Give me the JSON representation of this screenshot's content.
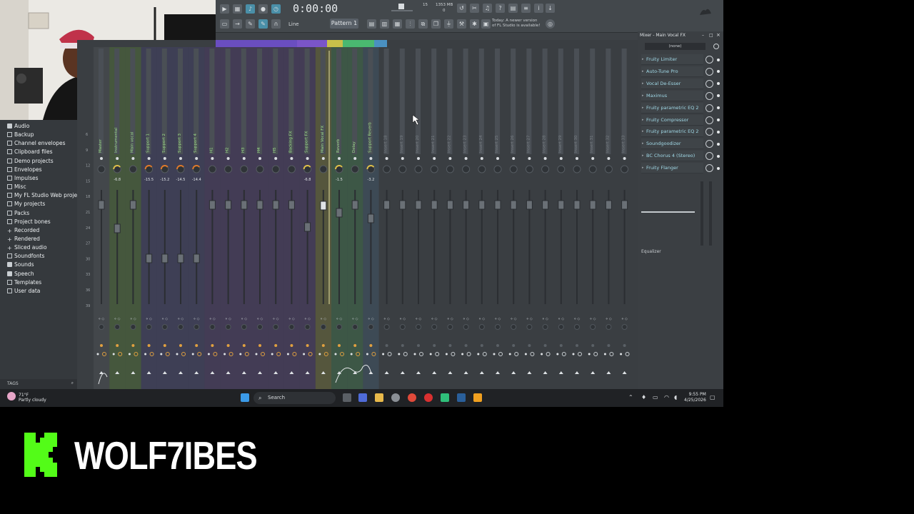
{
  "toolbar": {
    "time": "0:00:00",
    "pattern": "Pattern 1",
    "snap": "Line",
    "notice": "Today: A newer version of FL Studio is available!",
    "cpu": "15",
    "mem": "1353 MB",
    "voices": "0"
  },
  "browser": {
    "items": [
      {
        "label": "Audio",
        "icon": "speaker-icon"
      },
      {
        "label": "Backup",
        "icon": "folder-icon"
      },
      {
        "label": "Channel envelopes",
        "icon": "folder-icon"
      },
      {
        "label": "Clipboard files",
        "icon": "folder-icon"
      },
      {
        "label": "Demo projects",
        "icon": "folder-icon"
      },
      {
        "label": "Envelopes",
        "icon": "folder-icon"
      },
      {
        "label": "Impulses",
        "icon": "folder-icon"
      },
      {
        "label": "Misc",
        "icon": "folder-icon"
      },
      {
        "label": "My FL Studio Web projects",
        "icon": "folder-icon"
      },
      {
        "label": "My projects",
        "icon": "folder-icon"
      },
      {
        "label": "Packs",
        "icon": "folder-icon"
      },
      {
        "label": "Project bones",
        "icon": "folder-icon"
      },
      {
        "label": "Recorded",
        "icon": "plus-icon"
      },
      {
        "label": "Rendered",
        "icon": "plus-icon"
      },
      {
        "label": "Sliced audio",
        "icon": "plus-icon"
      },
      {
        "label": "Soundfonts",
        "icon": "folder-icon"
      },
      {
        "label": "Sounds",
        "icon": "speaker-icon"
      },
      {
        "label": "Speech",
        "icon": "speaker-icon"
      },
      {
        "label": "Templates",
        "icon": "folder-icon"
      },
      {
        "label": "User data",
        "icon": "folder-icon"
      }
    ],
    "tags_label": "TAGS"
  },
  "mixer": {
    "tracks": [
      {
        "name": "Master",
        "db": "",
        "color": "#4a4f54"
      },
      {
        "name": "Instrumental",
        "db": "-6.8",
        "color": "#4f6b3a"
      },
      {
        "name": "Main vocal",
        "db": "",
        "color": "#4f6b3a"
      },
      {
        "name": "Support 1",
        "db": "-15.5",
        "color": "#423f66"
      },
      {
        "name": "Support 2",
        "db": "-15.2",
        "color": "#423f66"
      },
      {
        "name": "Support 3",
        "db": "-14.5",
        "color": "#423f66"
      },
      {
        "name": "Support 4",
        "db": "-14.4",
        "color": "#423f66"
      },
      {
        "name": "H1",
        "db": "",
        "color": "#4a3a66"
      },
      {
        "name": "H2",
        "db": "",
        "color": "#4a3a66"
      },
      {
        "name": "H3",
        "db": "",
        "color": "#4a3a66"
      },
      {
        "name": "H4",
        "db": "",
        "color": "#4a3a66"
      },
      {
        "name": "H5",
        "db": "",
        "color": "#4a3a66"
      },
      {
        "name": "Backing FX",
        "db": "",
        "color": "#4a3a66"
      },
      {
        "name": "Support FX",
        "db": "-6.8",
        "color": "#4a3a66"
      },
      {
        "name": "Main Vocal FX",
        "db": "",
        "color": "#6b6a3a"
      },
      {
        "name": "Reverb",
        "db": "-1.5",
        "color": "#3f6b4a"
      },
      {
        "name": "Delay",
        "db": "",
        "color": "#3f6b4a"
      },
      {
        "name": "Support Reverb",
        "db": "-3.2",
        "color": "#3f5466"
      },
      {
        "name": "Insert 18",
        "db": "",
        "color": ""
      },
      {
        "name": "Insert 19",
        "db": "",
        "color": ""
      },
      {
        "name": "Insert 20",
        "db": "",
        "color": ""
      },
      {
        "name": "Insert 21",
        "db": "",
        "color": ""
      },
      {
        "name": "Insert 22",
        "db": "",
        "color": ""
      },
      {
        "name": "Insert 23",
        "db": "",
        "color": ""
      },
      {
        "name": "Insert 24",
        "db": "",
        "color": ""
      },
      {
        "name": "Insert 25",
        "db": "",
        "color": ""
      },
      {
        "name": "Insert 26",
        "db": "",
        "color": ""
      },
      {
        "name": "Insert 27",
        "db": "",
        "color": ""
      },
      {
        "name": "Insert 28",
        "db": "",
        "color": ""
      },
      {
        "name": "Insert 29",
        "db": "",
        "color": ""
      },
      {
        "name": "Insert 30",
        "db": "",
        "color": ""
      },
      {
        "name": "Insert 31",
        "db": "",
        "color": ""
      },
      {
        "name": "Insert 32",
        "db": "",
        "color": ""
      },
      {
        "name": "Insert 33",
        "db": "",
        "color": ""
      }
    ],
    "scale": [
      "6",
      "9",
      "12",
      "15",
      "18",
      "21",
      "24",
      "27",
      "30",
      "33",
      "36",
      "39"
    ]
  },
  "panel": {
    "title": "Mixer - Main Vocal FX",
    "input": "(none)",
    "slots": [
      "Fruity Limiter",
      "Auto-Tune Pro",
      "Vocal De-Esser",
      "Maximus",
      "Fruity parametric EQ 2",
      "Fruity Compressor",
      "Fruity parametric EQ 2",
      "Soundgoodizer",
      "BC Chorus 4 (Stereo)",
      "Fruity Flanger"
    ],
    "eq_label": "Equalizer"
  },
  "taskbar": {
    "temp": "71°F",
    "weather": "Partly cloudy",
    "search": "Search",
    "time": "9:55 PM",
    "date": "4/25/2026"
  },
  "brand": {
    "name": "WOLF7IBES"
  }
}
